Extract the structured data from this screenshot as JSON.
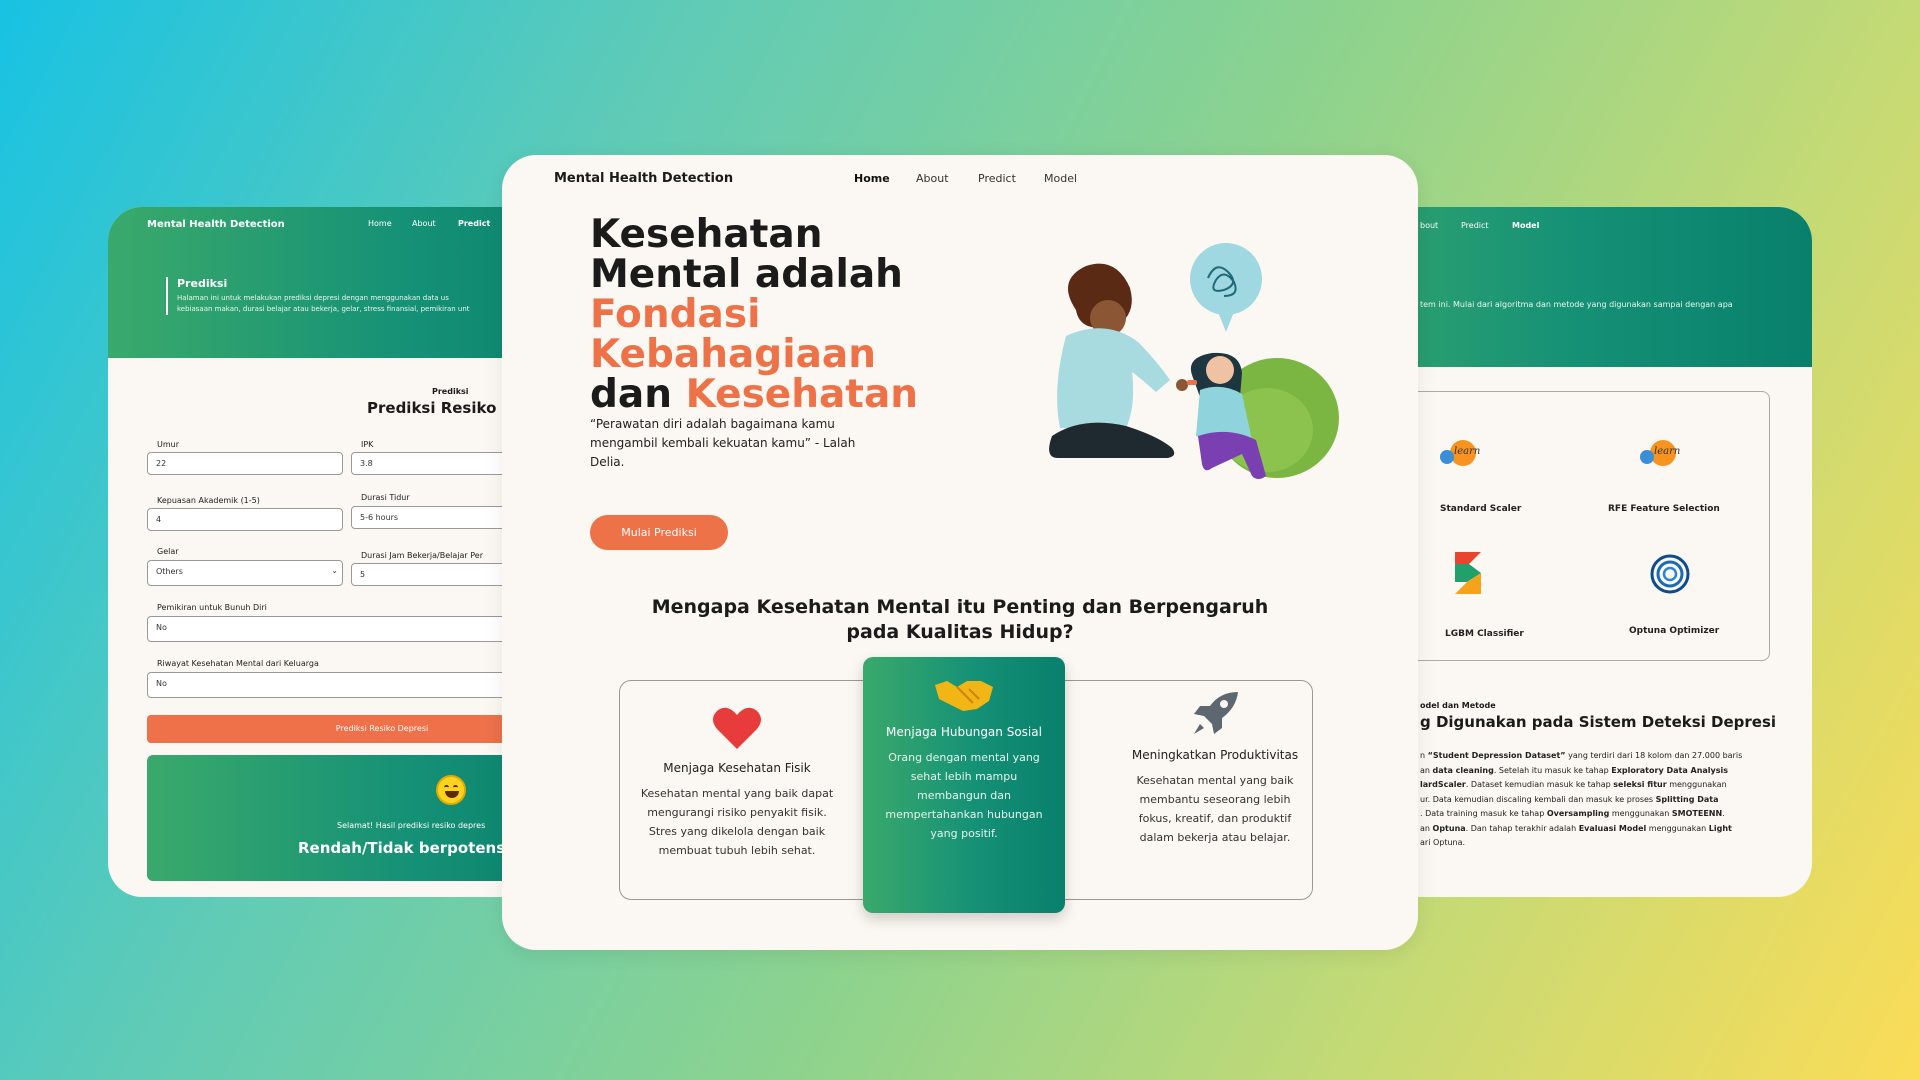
{
  "left": {
    "brand": "Mental Health Detection",
    "nav": [
      "Home",
      "About",
      "Predict"
    ],
    "section_title": "Prediksi",
    "section_desc_lines": [
      "Halaman ini untuk melakukan prediksi depresi dengan menggunakan data us",
      "kebiasaan makan, durasi belajar atau bekerja, gelar, stress finansial, pemikiran unt"
    ],
    "form_small_title": "Prediksi",
    "form_title": "Prediksi Resiko Dep",
    "fields": {
      "umur": {
        "label": "Umur",
        "value": "22"
      },
      "ipk": {
        "label": "IPK",
        "value": "3.8"
      },
      "kepuasan": {
        "label": "Kepuasan Akademik (1-5)",
        "value": "4"
      },
      "durasi_tidur": {
        "label": "Durasi Tidur",
        "value": "5-6 hours"
      },
      "gelar": {
        "label": "Gelar",
        "value": "Others"
      },
      "durasi_kerja": {
        "label": "Durasi Jam Bekerja/Belajar Per",
        "value": "5"
      },
      "bunuh_diri": {
        "label": "Pemikiran untuk Bunuh Diri",
        "value": "No"
      },
      "riwayat": {
        "label": "Riwayat Kesehatan Mental dari Keluarga",
        "value": "No"
      }
    },
    "submit_label": "Prediksi Resiko Depresi",
    "result": {
      "line1": "Selamat! Hasil prediksi resiko depres",
      "line2": "Rendah/Tidak berpotensi me",
      "emoji": "grinning-face-icon"
    }
  },
  "main": {
    "brand": "Mental Health Detection",
    "nav": [
      "Home",
      "About",
      "Predict",
      "Model"
    ],
    "hero": {
      "p1": "Kesehatan Mental adalah ",
      "p2": "Fondasi Kebahagiaan",
      "p3": " dan ",
      "p4": "Kesehatan"
    },
    "quote": "“Perawatan diri adalah bagaimana kamu mengambil kembali kekuatan kamu” - Lalah Delia.",
    "cta": "Mulai Prediksi",
    "why_title": "Mengapa Kesehatan Mental itu Penting dan Berpengaruh pada Kualitas Hidup?",
    "features": [
      {
        "icon": "heart-icon",
        "title": "Menjaga Kesehatan Fisik",
        "desc": "Kesehatan mental yang baik dapat mengurangi risiko penyakit fisik. Stres yang dikelola dengan baik membuat tubuh lebih sehat."
      },
      {
        "icon": "handshake-icon",
        "title": "Menjaga Hubungan Sosial",
        "desc": "Orang dengan mental yang sehat lebih mampu membangun dan mempertahankan hubungan yang positif."
      },
      {
        "icon": "rocket-icon",
        "title": "Meningkatkan Produktivitas",
        "desc": "Kesehatan mental yang baik membantu seseorang lebih fokus, kreatif, dan produktif dalam bekerja atau belajar."
      }
    ],
    "accent_orange": "#ee7247",
    "accent_green": "#159176"
  },
  "right": {
    "nav": [
      "bout",
      "Predict",
      "Model"
    ],
    "desc": "tem ini. Mulai dari algoritma dan metode yang digunakan sampai dengan apa",
    "models": [
      {
        "name": "Standard Scaler",
        "logo": "sklearn-logo"
      },
      {
        "name": "RFE Feature Selection",
        "logo": "sklearn-logo"
      },
      {
        "name": "LGBM Classifier",
        "logo": "lightgbm-logo"
      },
      {
        "name": "Optuna Optimizer",
        "logo": "optuna-logo"
      }
    ],
    "logo_text": "learn",
    "sub": "odel dan Metode",
    "title": "g Digunakan pada Sistem Deteksi Depresi",
    "body_lines": [
      [
        "n ",
        "“Student Depression Dataset”",
        " yang terdiri dari 18 kolom dan 27.000 baris"
      ],
      [
        "an ",
        "data cleaning",
        ". Setelah itu masuk ke tahap ",
        "Exploratory Data Analysis"
      ],
      [
        "lardScaler",
        ". Dataset kemudian masuk ke tahap ",
        "seleksi fitur",
        " menggunakan"
      ],
      [
        "ur. Data kemudian discaling kembali dan masuk ke proses ",
        "Splitting Data"
      ],
      [
        ". Data training masuk ke tahap ",
        "Oversampling",
        " menggunakan ",
        "SMOTEENN",
        "."
      ],
      [
        "an ",
        "Optuna",
        ". Dan tahap terakhir adalah ",
        "Evaluasi Model",
        " menggunakan ",
        "Light"
      ],
      [
        "ari Optuna."
      ]
    ]
  }
}
